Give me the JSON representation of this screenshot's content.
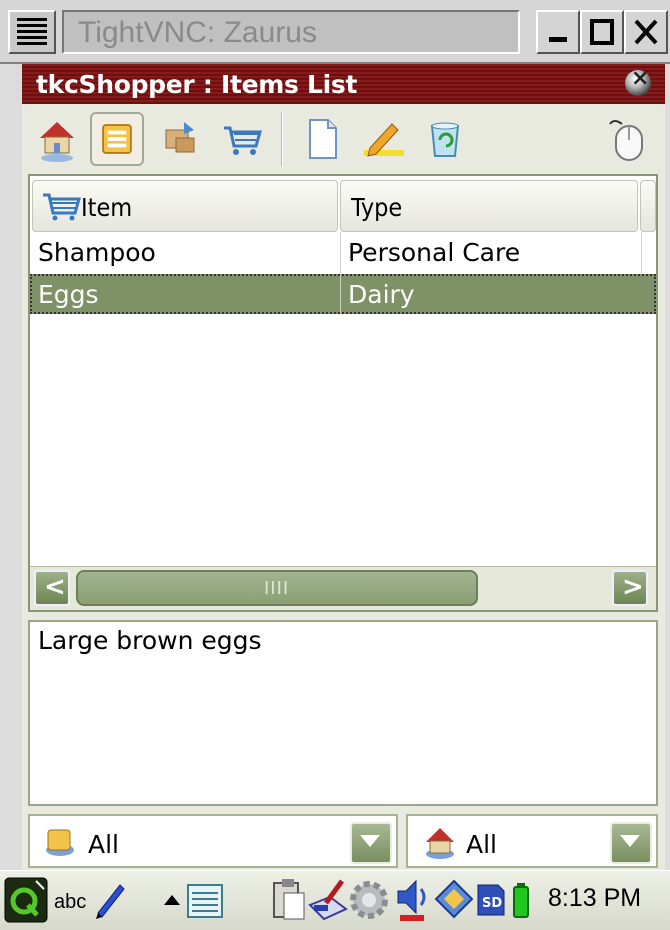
{
  "vnc": {
    "title": "TightVNC: Zaurus",
    "minimize_icon": "minimize-icon",
    "maximize_icon": "maximize-icon",
    "close_icon": "close-icon"
  },
  "app": {
    "title": "tkcShopper : Items List",
    "title_bar_color": "#7a1414"
  },
  "toolbar": {
    "buttons": [
      {
        "name": "home-icon"
      },
      {
        "name": "items-list-icon",
        "active": true
      },
      {
        "name": "stores-icon"
      },
      {
        "name": "shopping-cart-icon"
      },
      {
        "name": "new-document-icon"
      },
      {
        "name": "edit-pencil-icon"
      },
      {
        "name": "recycle-bin-icon"
      },
      {
        "name": "mouse-icon"
      }
    ]
  },
  "list": {
    "columns": [
      {
        "label": "Item",
        "icon": "cart-icon"
      },
      {
        "label": "Type"
      }
    ],
    "rows": [
      {
        "item": "Shampoo",
        "type": "Personal Care",
        "selected": false
      },
      {
        "item": "Eggs",
        "type": "Dairy",
        "selected": true
      }
    ],
    "selection_color": "#7f9166",
    "scroll_grip": "IIII"
  },
  "notes": {
    "text": "Large brown eggs"
  },
  "filters": {
    "left": {
      "value": "All",
      "icon": "category-icon"
    },
    "right": {
      "value": "All",
      "icon": "store-icon"
    }
  },
  "taskbar": {
    "input_method": "abc",
    "clock": "8:13 PM",
    "icons": [
      "q-menu-icon",
      "pen-icon",
      "up-arrow-icon",
      "keyboard-icon",
      "clipboard-icon",
      "paint-icon",
      "settings-gear-icon",
      "volume-icon",
      "sync-icon",
      "sd-card-icon",
      "battery-icon"
    ]
  }
}
